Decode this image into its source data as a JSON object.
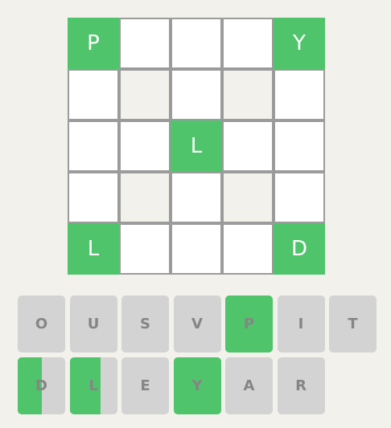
{
  "colors": {
    "background": "#f2f1ec",
    "tile_empty": "#ffffff",
    "tile_green": "#4fc46b",
    "tile_border": "#9b9b9b",
    "key_default": "#d3d3d3",
    "key_text": "#858585"
  },
  "board": {
    "rows": [
      [
        {
          "letter": "P",
          "state": "green"
        },
        {
          "letter": "",
          "state": "empty"
        },
        {
          "letter": "",
          "state": "empty"
        },
        {
          "letter": "",
          "state": "empty"
        },
        {
          "letter": "Y",
          "state": "green"
        }
      ],
      [
        {
          "letter": "",
          "state": "empty"
        },
        {
          "letter": "",
          "state": "hole"
        },
        {
          "letter": "",
          "state": "empty"
        },
        {
          "letter": "",
          "state": "hole"
        },
        {
          "letter": "",
          "state": "empty"
        }
      ],
      [
        {
          "letter": "",
          "state": "empty"
        },
        {
          "letter": "",
          "state": "empty"
        },
        {
          "letter": "L",
          "state": "green"
        },
        {
          "letter": "",
          "state": "empty"
        },
        {
          "letter": "",
          "state": "empty"
        }
      ],
      [
        {
          "letter": "",
          "state": "empty"
        },
        {
          "letter": "",
          "state": "hole"
        },
        {
          "letter": "",
          "state": "empty"
        },
        {
          "letter": "",
          "state": "hole"
        },
        {
          "letter": "",
          "state": "empty"
        }
      ],
      [
        {
          "letter": "L",
          "state": "green"
        },
        {
          "letter": "",
          "state": "empty"
        },
        {
          "letter": "",
          "state": "empty"
        },
        {
          "letter": "",
          "state": "empty"
        },
        {
          "letter": "D",
          "state": "green"
        }
      ]
    ]
  },
  "keyboard": {
    "rows": [
      [
        {
          "label": "O",
          "green_fraction": 0
        },
        {
          "label": "U",
          "green_fraction": 0
        },
        {
          "label": "S",
          "green_fraction": 0
        },
        {
          "label": "V",
          "green_fraction": 0
        },
        {
          "label": "P",
          "green_fraction": 1
        },
        {
          "label": "I",
          "green_fraction": 0
        },
        {
          "label": "T",
          "green_fraction": 0
        }
      ],
      [
        {
          "label": "D",
          "green_fraction": 0.5
        },
        {
          "label": "L",
          "green_fraction": 0.66
        },
        {
          "label": "E",
          "green_fraction": 0
        },
        {
          "label": "Y",
          "green_fraction": 1
        },
        {
          "label": "A",
          "green_fraction": 0
        },
        {
          "label": "R",
          "green_fraction": 0
        }
      ]
    ]
  }
}
